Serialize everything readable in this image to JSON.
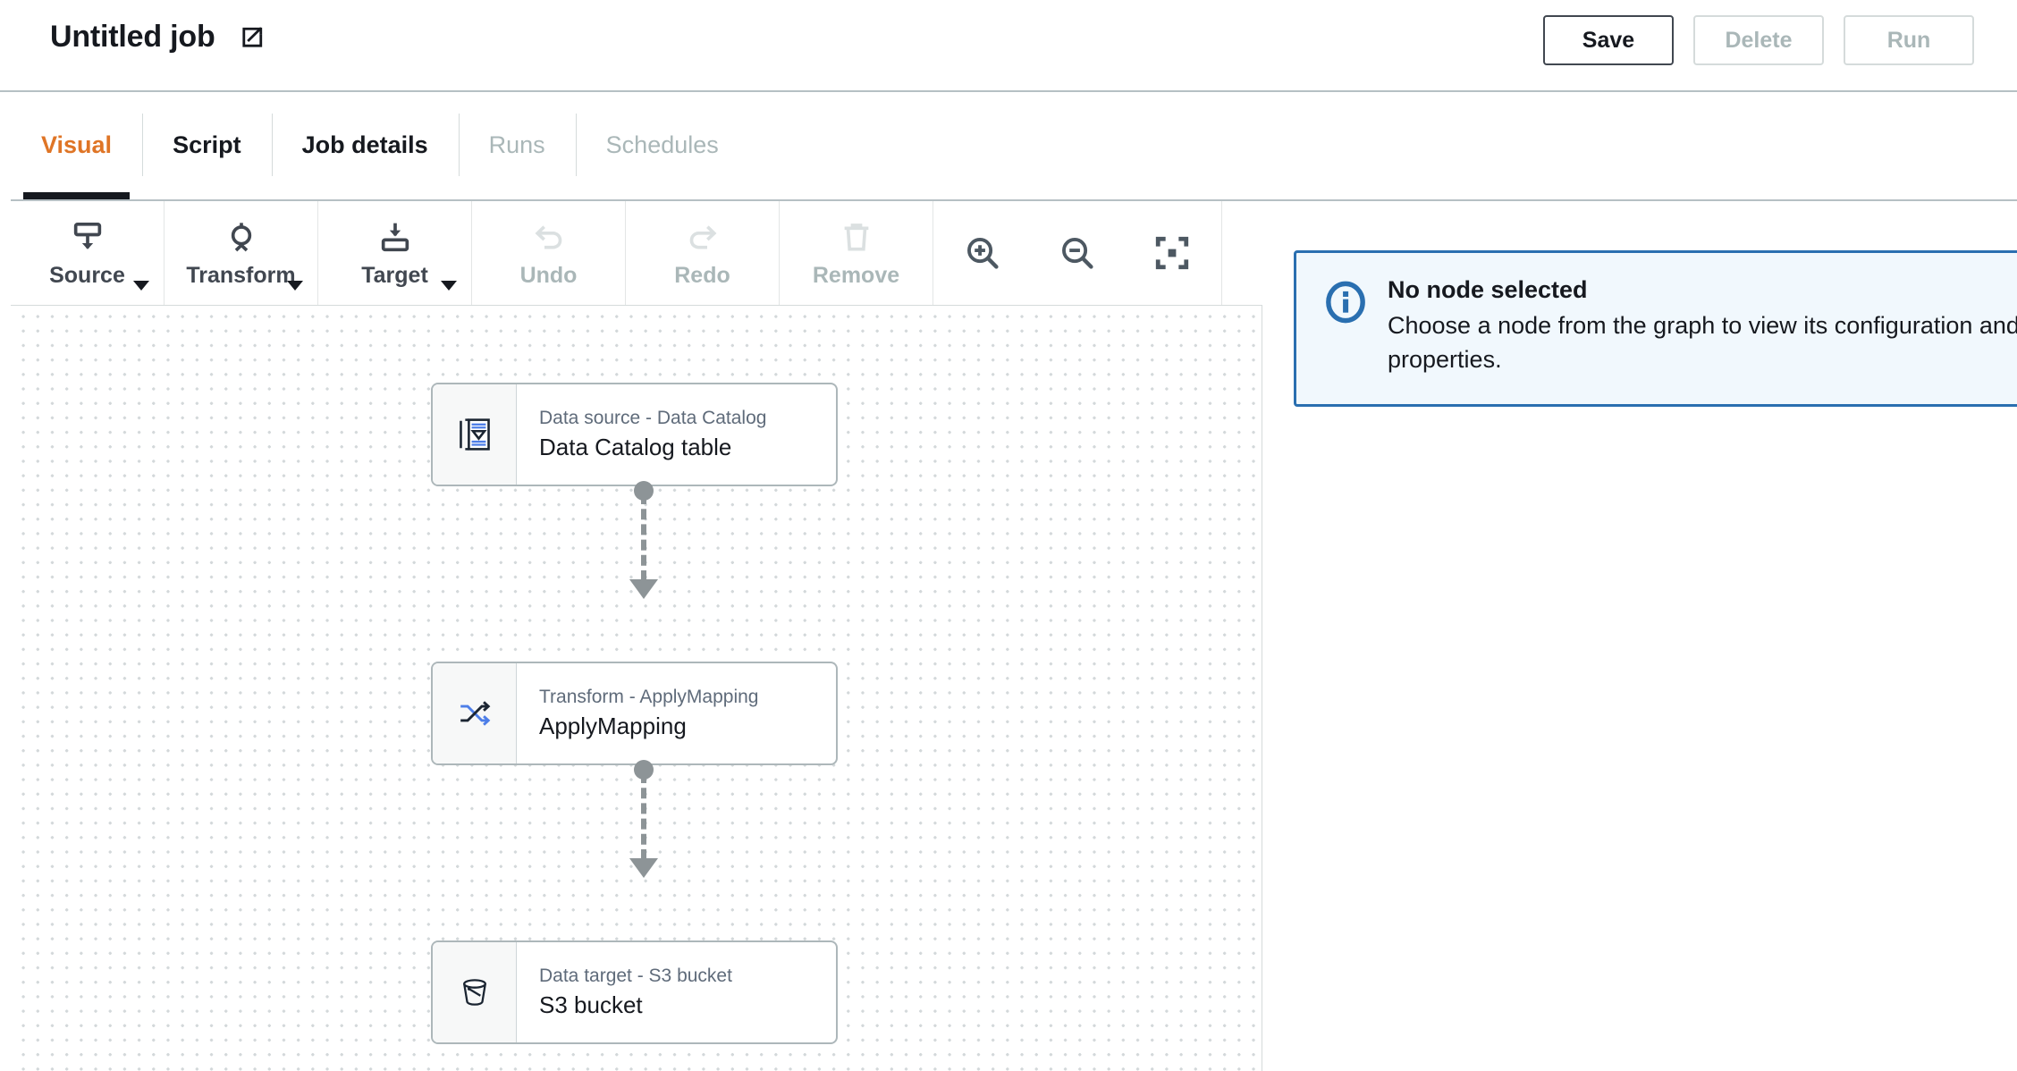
{
  "header": {
    "job_title": "Untitled job",
    "edit_icon": "edit-pencil-icon",
    "buttons": [
      {
        "label": "Save",
        "state": "enabled"
      },
      {
        "label": "Delete",
        "state": "disabled"
      },
      {
        "label": "Run",
        "state": "disabled"
      }
    ]
  },
  "tabs": [
    {
      "label": "Visual",
      "state": "active"
    },
    {
      "label": "Script",
      "state": "enabled"
    },
    {
      "label": "Job details",
      "state": "enabled"
    },
    {
      "label": "Runs",
      "state": "disabled"
    },
    {
      "label": "Schedules",
      "state": "disabled"
    }
  ],
  "toolbar": {
    "items": [
      {
        "label": "Source",
        "icon": "source-node-icon",
        "state": "enabled",
        "has_caret": true
      },
      {
        "label": "Transform",
        "icon": "transform-node-icon",
        "state": "enabled",
        "has_caret": true
      },
      {
        "label": "Target",
        "icon": "target-node-icon",
        "state": "enabled",
        "has_caret": true
      },
      {
        "label": "Undo",
        "icon": "undo-arrow-icon",
        "state": "disabled",
        "has_caret": false
      },
      {
        "label": "Redo",
        "icon": "redo-arrow-icon",
        "state": "disabled",
        "has_caret": false
      },
      {
        "label": "Remove",
        "icon": "trash-icon",
        "state": "disabled",
        "has_caret": false
      }
    ],
    "zoom_controls": [
      {
        "icon": "zoom-in-icon"
      },
      {
        "icon": "zoom-out-icon"
      },
      {
        "icon": "fit-to-screen-icon"
      }
    ]
  },
  "graph": {
    "nodes": [
      {
        "type": "Data source - Data Catalog",
        "name": "Data Catalog table",
        "icon": "data-catalog-table-icon"
      },
      {
        "type": "Transform - ApplyMapping",
        "name": "ApplyMapping",
        "icon": "apply-mapping-icon"
      },
      {
        "type": "Data target - S3 bucket",
        "name": "S3 bucket",
        "icon": "s3-bucket-icon"
      }
    ]
  },
  "details_panel": {
    "alert": {
      "icon": "info-circle-icon",
      "title": "No node selected",
      "body": "Choose a node from the graph to view its configuration and properties.",
      "accent_color": "#2a6fb0",
      "background_color": "#f1f8fd"
    }
  },
  "colors": {
    "active_tab": "#df7526",
    "active_tab_underline": "#16191f",
    "text": "#16191f",
    "muted_text": "#5f6b7a",
    "disabled_text": "#aab7b8",
    "border": "#d5dbdb",
    "edge": "#8d9497"
  }
}
